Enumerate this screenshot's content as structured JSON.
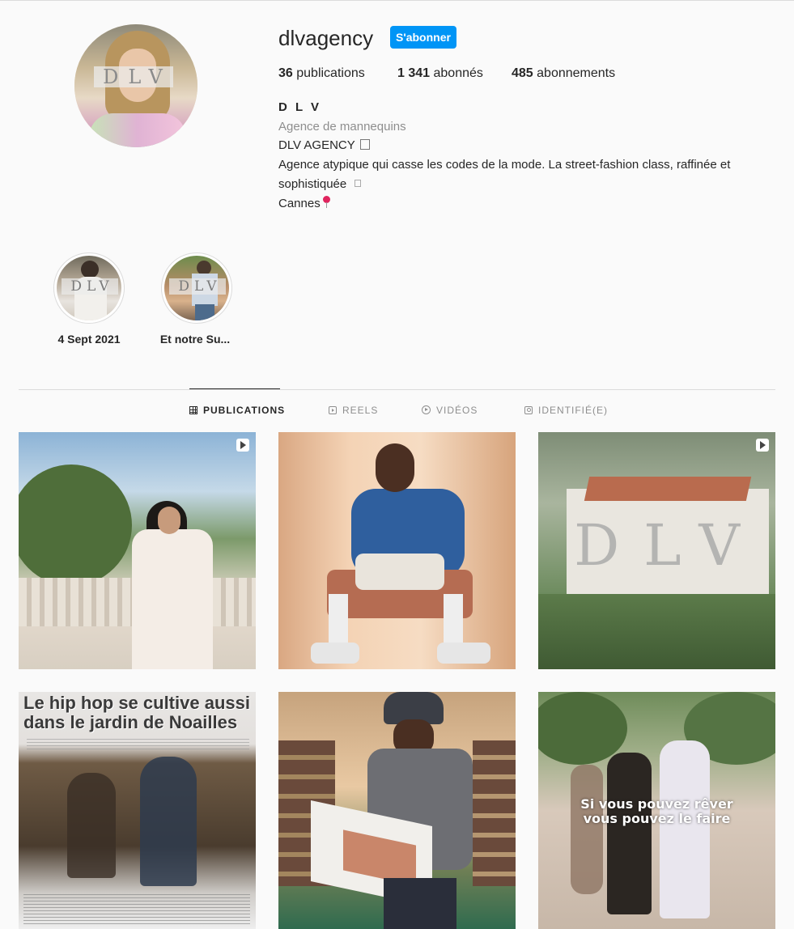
{
  "profile": {
    "username": "dlvagency",
    "follow_label": "S'abonner",
    "avatar_logo": "DLV",
    "stats": {
      "posts_count": "36",
      "posts_label": " publications",
      "followers_count": "1 341",
      "followers_label": " abonnés",
      "following_count": "485",
      "following_label": " abonnements"
    },
    "bio": {
      "name": "D L V",
      "category": "Agence de mannequins",
      "line1": "DLV AGENCY",
      "line2a": "Agence atypique qui casse les codes de la mode. La street-fashion class, raffinée et",
      "line2b": "sophistiquée",
      "location": "Cannes"
    }
  },
  "highlights": [
    {
      "label": "4 Sept 2021",
      "logo": "DLV"
    },
    {
      "label": "Et notre Su...",
      "logo": "DLV"
    }
  ],
  "tabs": [
    {
      "label": "PUBLICATIONS",
      "icon": "grid-icon",
      "active": true
    },
    {
      "label": "REELS",
      "icon": "reels-icon",
      "active": false
    },
    {
      "label": "VIDÉOS",
      "icon": "video-icon",
      "active": false
    },
    {
      "label": "IDENTIFIÉ(E)",
      "icon": "tagged-icon",
      "active": false
    }
  ],
  "posts": {
    "p3_logo": "DLV",
    "p4_title": "Le hip hop se cultive aussi dans le jardin de Noailles",
    "p6_caption_1": "Si vous pouvez rêver",
    "p6_caption_2": "vous pouvez le faire"
  },
  "colors": {
    "accent": "#0095f6",
    "text": "#262626",
    "muted": "#8e8e8e",
    "background": "#fafafa",
    "border": "#dbdbdb"
  }
}
